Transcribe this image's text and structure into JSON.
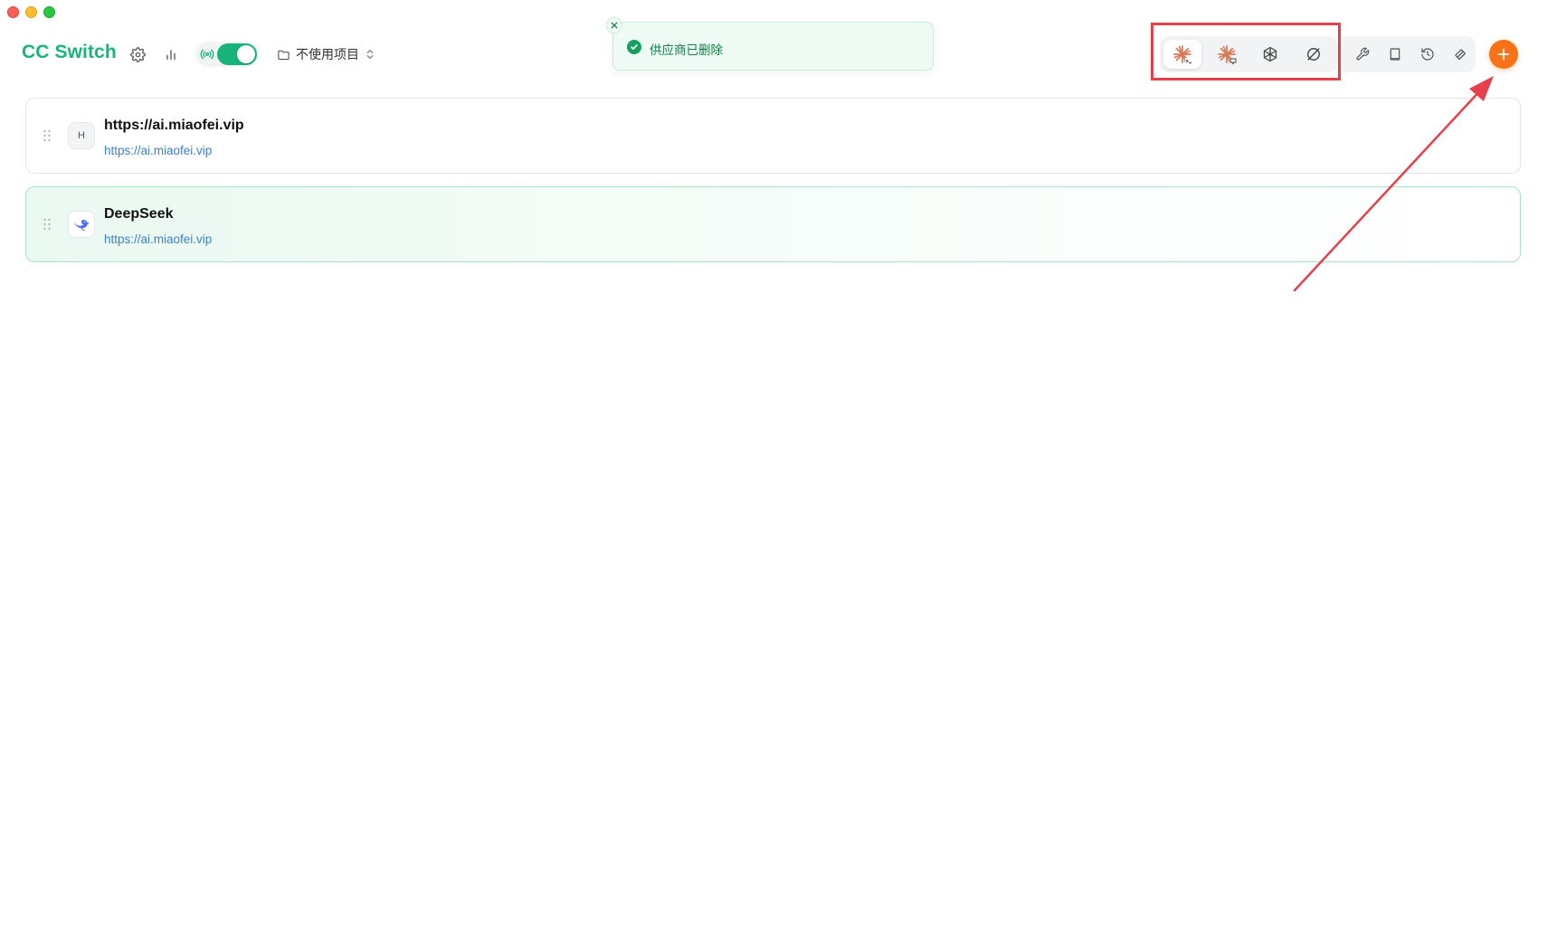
{
  "app": {
    "title": "CC Switch"
  },
  "header": {
    "project_selector": {
      "label": "不使用项目",
      "icon": "folder-icon"
    },
    "proxy_toggle": {
      "enabled": true,
      "icon": "broadcast-icon"
    },
    "icons": [
      "gear-icon",
      "bar-chart-icon"
    ]
  },
  "toast": {
    "message": "供应商已删除",
    "type": "success"
  },
  "app_switcher": {
    "items": [
      {
        "name": "claude-code",
        "icon": "claude-code-icon",
        "active": true
      },
      {
        "name": "claude-desktop",
        "icon": "claude-desktop-icon",
        "active": false
      },
      {
        "name": "openai-codex",
        "icon": "openai-icon",
        "active": false
      },
      {
        "name": "gemini",
        "icon": "gemini-icon",
        "active": false
      }
    ]
  },
  "tools": [
    "wrench-icon",
    "book-icon",
    "history-icon",
    "layers-icon"
  ],
  "add_button": {
    "icon": "plus-icon"
  },
  "providers": [
    {
      "avatar_letter": "H",
      "name": "https://ai.miaofei.vip",
      "url": "https://ai.miaofei.vip",
      "active": false
    },
    {
      "avatar_icon": "deepseek-whale-icon",
      "name": "DeepSeek",
      "url": "https://ai.miaofei.vip",
      "active": true
    }
  ],
  "colors": {
    "brand_green": "#19b47a",
    "accent_orange": "#f97316",
    "annotation_red": "#e8404a",
    "link_blue": "#3b82c4"
  }
}
